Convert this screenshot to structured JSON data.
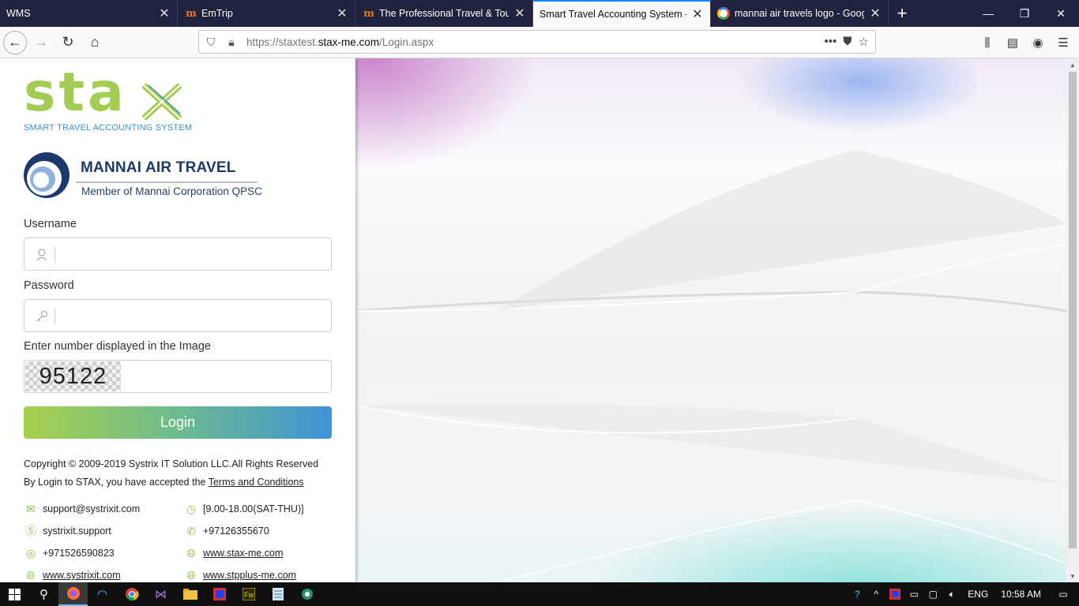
{
  "browser": {
    "tabs": [
      {
        "title": "WMS",
        "favicon": "none",
        "active": false
      },
      {
        "title": "EmTrip",
        "favicon": "m-logo-icon",
        "active": false
      },
      {
        "title": "The Professional Travel & Tours",
        "favicon": "m-logo-icon",
        "active": false
      },
      {
        "title": "Smart Travel Accounting System - S",
        "favicon": "none",
        "active": true
      },
      {
        "title": "mannai air travels logo - Googl",
        "favicon": "google-icon",
        "active": false
      }
    ],
    "url_prefix": "https://staxtest.",
    "url_domain": "stax-me.com",
    "url_path": "/Login.aspx"
  },
  "branding": {
    "stax_word": "sta",
    "stax_tagline": "SMART TRAVEL ACCOUNTING SYSTEM",
    "company_name": "MANNAI AIR TRAVEL",
    "company_sub": "Member of Mannai Corporation QPSC",
    "accent_green": "#a3cc52",
    "accent_blue": "#3a8fc8"
  },
  "form": {
    "username_label": "Username",
    "username_value": "",
    "password_label": "Password",
    "password_value": "",
    "captcha_label": "Enter number displayed in the Image",
    "captcha_number": "95122",
    "captcha_value": "",
    "login_label": "Login"
  },
  "footer": {
    "copyright": "Copyright © 2009-2019 Systrix IT Solution LLC.All Rights Reserved",
    "accept_prefix": "By Login to STAX, you have accepted the ",
    "terms_link": "Terms and Conditions"
  },
  "contacts": {
    "email": "support@systrixit.com",
    "hours": "[9.00-18.00(SAT-THU)]",
    "skype": "systrixit.support",
    "phone": "+97126355670",
    "whatsapp": "+971526590823",
    "site1": "www.stax-me.com",
    "site2": "www.systrixit.com",
    "site3": "www.stpplus-me.com"
  },
  "taskbar": {
    "language": "ENG",
    "time": "10:58 AM"
  }
}
